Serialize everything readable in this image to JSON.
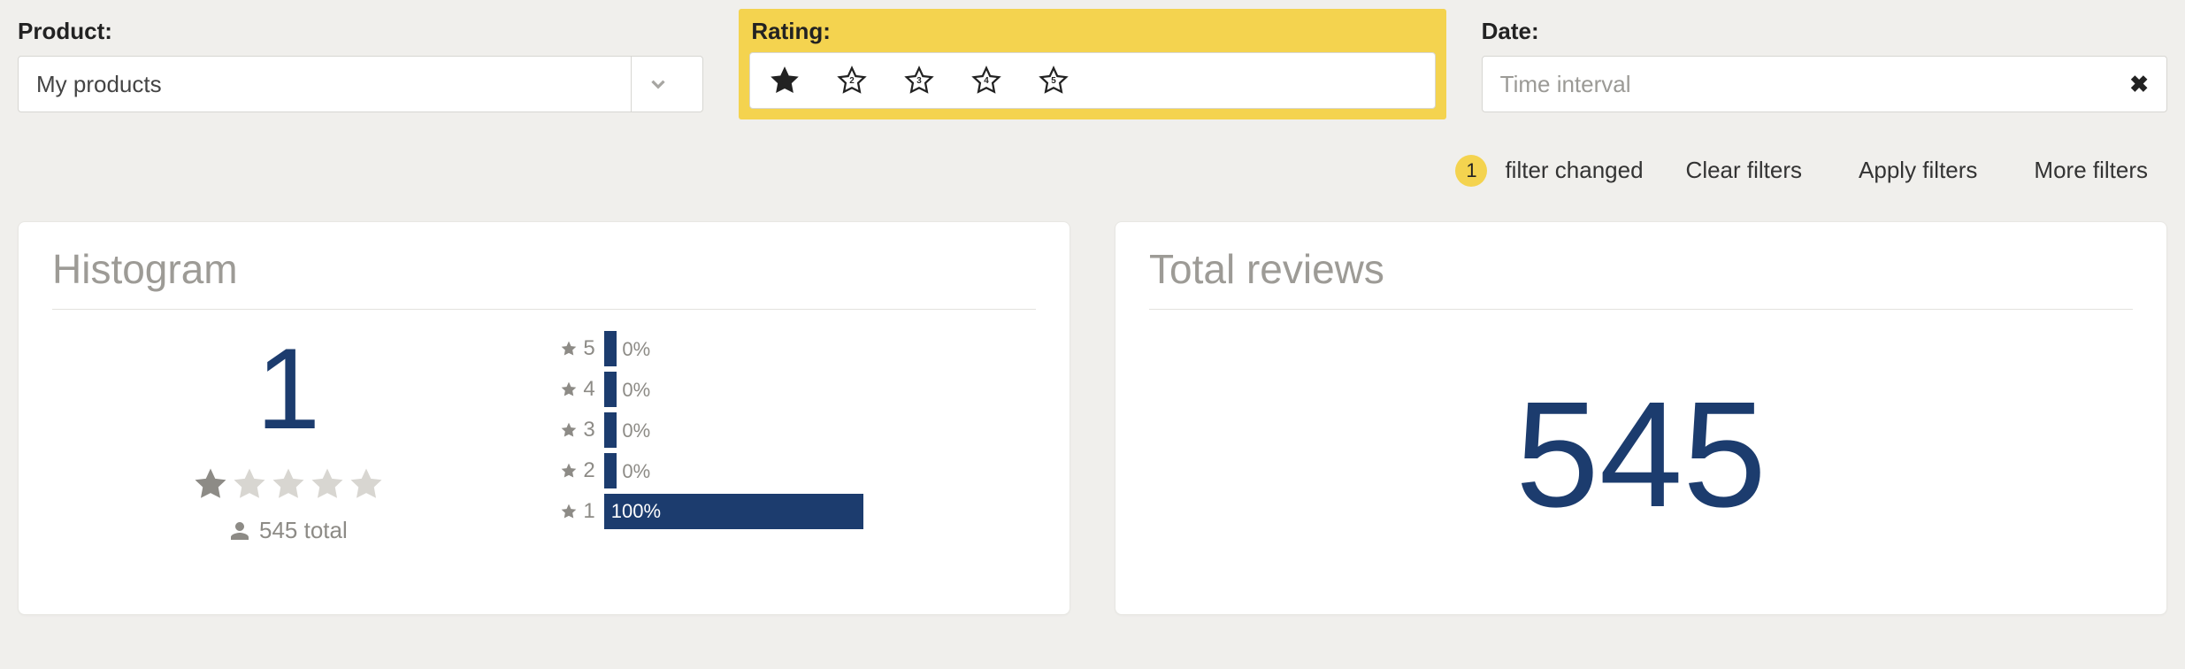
{
  "filters": {
    "product": {
      "label": "Product:",
      "value": "My products"
    },
    "rating": {
      "label": "Rating:",
      "stars": [
        1,
        2,
        3,
        4,
        5
      ],
      "selected": 1
    },
    "date": {
      "label": "Date:",
      "placeholder": "Time interval"
    }
  },
  "filter_bar": {
    "changed_count": "1",
    "changed_label": "filter changed",
    "clear": "Clear filters",
    "apply": "Apply filters",
    "more": "More filters"
  },
  "histogram": {
    "title": "Histogram",
    "average": "1",
    "stars_filled": 1,
    "total_label": "545 total"
  },
  "chart_data": {
    "type": "bar",
    "title": "Histogram",
    "xlabel": "",
    "ylabel": "",
    "categories": [
      "5",
      "4",
      "3",
      "2",
      "1"
    ],
    "values_pct": [
      0,
      0,
      0,
      0,
      100
    ],
    "labels": [
      "0%",
      "0%",
      "0%",
      "0%",
      "100%"
    ]
  },
  "total_reviews": {
    "title": "Total reviews",
    "value": "545"
  }
}
